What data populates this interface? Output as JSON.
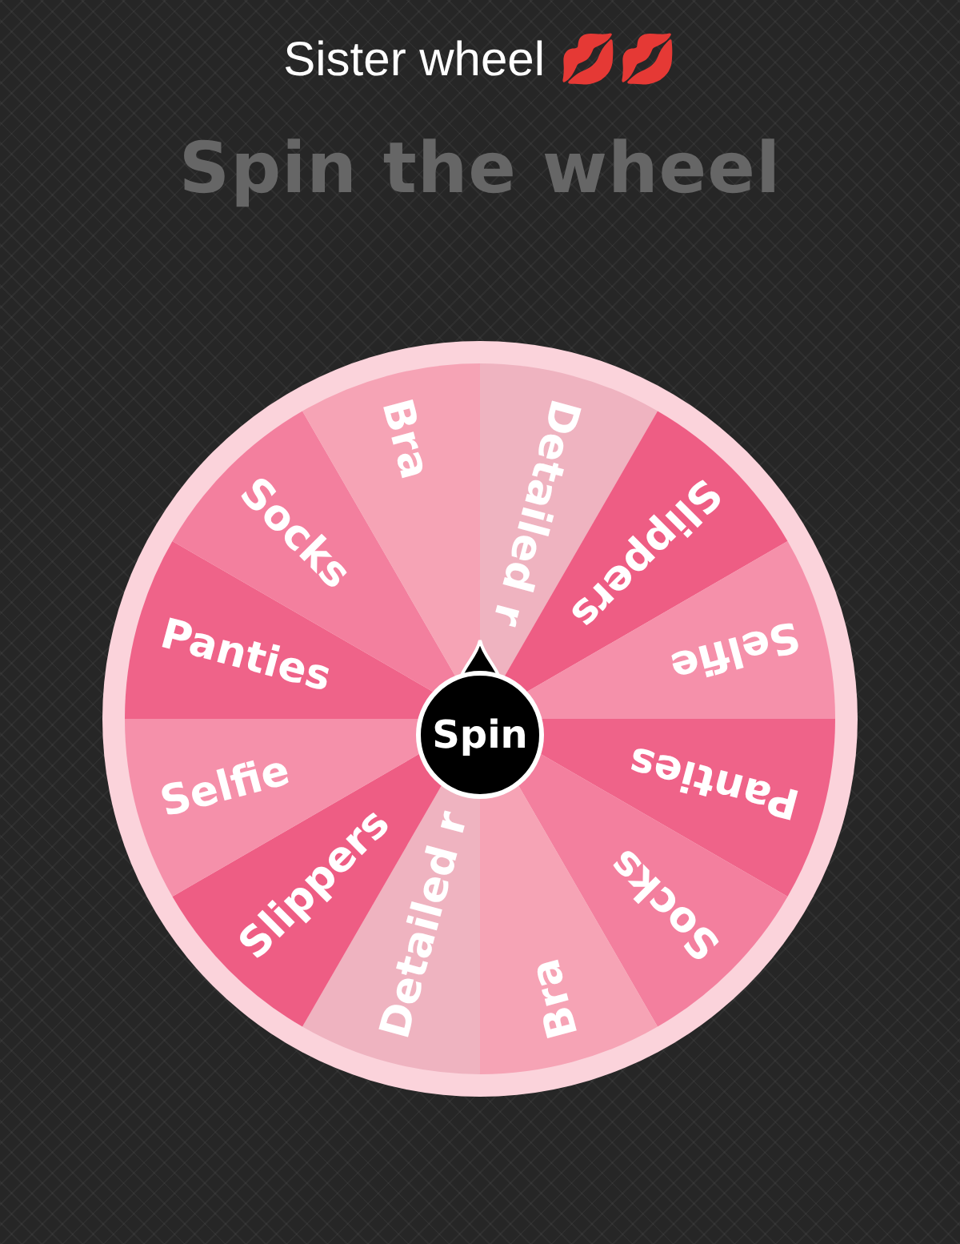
{
  "header": {
    "title": "Sister wheel 💋💋",
    "heading": "Spin the wheel"
  },
  "wheel": {
    "segments": [
      {
        "label": "Detailed r",
        "color": "#efb3c0"
      },
      {
        "label": "Slippers",
        "color": "#ee5d84"
      },
      {
        "label": "Selfie",
        "color": "#f590aa"
      },
      {
        "label": "Panties",
        "color": "#ef6389"
      },
      {
        "label": "Socks",
        "color": "#f37f9e"
      },
      {
        "label": "Bra",
        "color": "#f6a3b5"
      },
      {
        "label": "Detailed r",
        "color": "#efb3c0"
      },
      {
        "label": "Slippers",
        "color": "#ee5d84"
      },
      {
        "label": "Selfie",
        "color": "#f590aa"
      },
      {
        "label": "Panties",
        "color": "#ef6389"
      },
      {
        "label": "Socks",
        "color": "#f37f9e"
      },
      {
        "label": "Bra",
        "color": "#f6a3b5"
      }
    ],
    "button": "Spin"
  }
}
